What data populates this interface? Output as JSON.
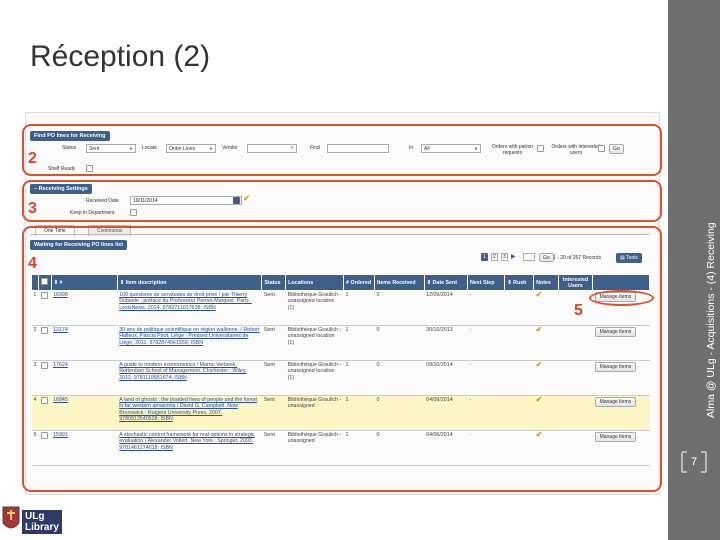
{
  "slide": {
    "title": "Réception (2)",
    "side_label": "Alma @ ULg - Acquisitions - (4) Receiving",
    "page_number": "7",
    "markers": [
      "2",
      "3",
      "4",
      "5"
    ],
    "logo": {
      "line1": "ULg",
      "line2": "Library"
    }
  },
  "find_panel": {
    "title": "Find PO lines for Receiving",
    "status_label": "Status",
    "status_value": "Sent",
    "locate_label": "Locate",
    "locate_value": "Order Lines",
    "vendor_label": "Vendor",
    "find_label": "Find",
    "in_label": "In",
    "in_value": "All",
    "orders_patron_label": "Orders with patron requests",
    "orders_interested_label": "Orders with interested users",
    "go_label": "Go",
    "shelf_ready_label": "Shelf Ready"
  },
  "receiving_settings": {
    "title": "Receiving Settings",
    "received_date_label": "Received Date",
    "received_date_value": "19/11/2014",
    "keep_in_dept_label": "Keep in Department"
  },
  "tabs": [
    "One Time",
    "Continuous"
  ],
  "list_title": "Waiting for Receiving PO lines list",
  "pager": {
    "pages": [
      "1",
      "2",
      "3"
    ],
    "records": "1 - 20 of 267 Records",
    "go_label": "Go",
    "tools_label": "Tools"
  },
  "columns": [
    "#",
    "Item description",
    "Status",
    "Locations",
    "# Ordered",
    "Items Received",
    "Date Sent",
    "Next Step",
    "Rush",
    "Notes",
    "Interested Users"
  ],
  "rows": [
    {
      "idx": "1",
      "po": "16998",
      "desc": "100 questions de servitudes de droit privé / par Thierry Dubaele ; préface du Professeur Pernet-Marquet. Paris : LexisNexis, 2014. 9782711017638; ISBN",
      "status": "Sent",
      "loc": "Bibliothèque Graulich - unassigned location (1)",
      "ordered": "1",
      "received": "0",
      "date": "12/09/2014",
      "next": "-",
      "action": "Manage Items"
    },
    {
      "idx": "2",
      "po": "12174",
      "desc": "30 ans de politique scientifique en région wallonne. / Robert Halleux, Pascal Pirot, Liège : Presses Universitaires de Liège, 2011. 9782874561559; ISBN",
      "status": "Sent",
      "loc": "Bibliothèque Graulich - unassigned location (1)",
      "ordered": "1",
      "received": "0",
      "date": "30/10/2013",
      "next": "-",
      "action": "Manage Items"
    },
    {
      "idx": "3",
      "po": "17624",
      "desc": "A guide to modern econometrics / Marno Verbeek. Rotterdam School of Management, Chichester : Wiley, 2012. 9781119951674; ISBN",
      "status": "Sent",
      "loc": "Bibliothèque Graulich - unassigned location (1)",
      "ordered": "1",
      "received": "0",
      "date": "09/10/2014",
      "next": "-",
      "action": "Manage Items"
    },
    {
      "idx": "4",
      "po": "16845",
      "desc": "A land of ghosts : the braided lives of people and the forest in far western amazonia / David G. Campbell. New Brunswick : Rutgers University Press, 2007. 9780813540528; ISBN",
      "status": "Sent",
      "loc": "Bibliothèque Graulich - unassigned",
      "ordered": "1",
      "received": "0",
      "date": "04/09/2014",
      "next": "-",
      "action": "Manage Items"
    },
    {
      "idx": "5",
      "po": "15991",
      "desc": "A stochastic control framework for real options in strategic evaluation / Alexander Vollert. New York : Springer, 2003. 9781461274018; ISBN",
      "status": "Sent",
      "loc": "Bibliothèque Graulich - unassigned",
      "ordered": "1",
      "received": "0",
      "date": "04/06/2014",
      "next": "-",
      "action": "Manage Items"
    }
  ],
  "colors": {
    "accent": "#3d5f8a",
    "annotation": "#e0502b",
    "side_bar": "#6f6f6f",
    "highlight_row": "#fbf6c4"
  }
}
